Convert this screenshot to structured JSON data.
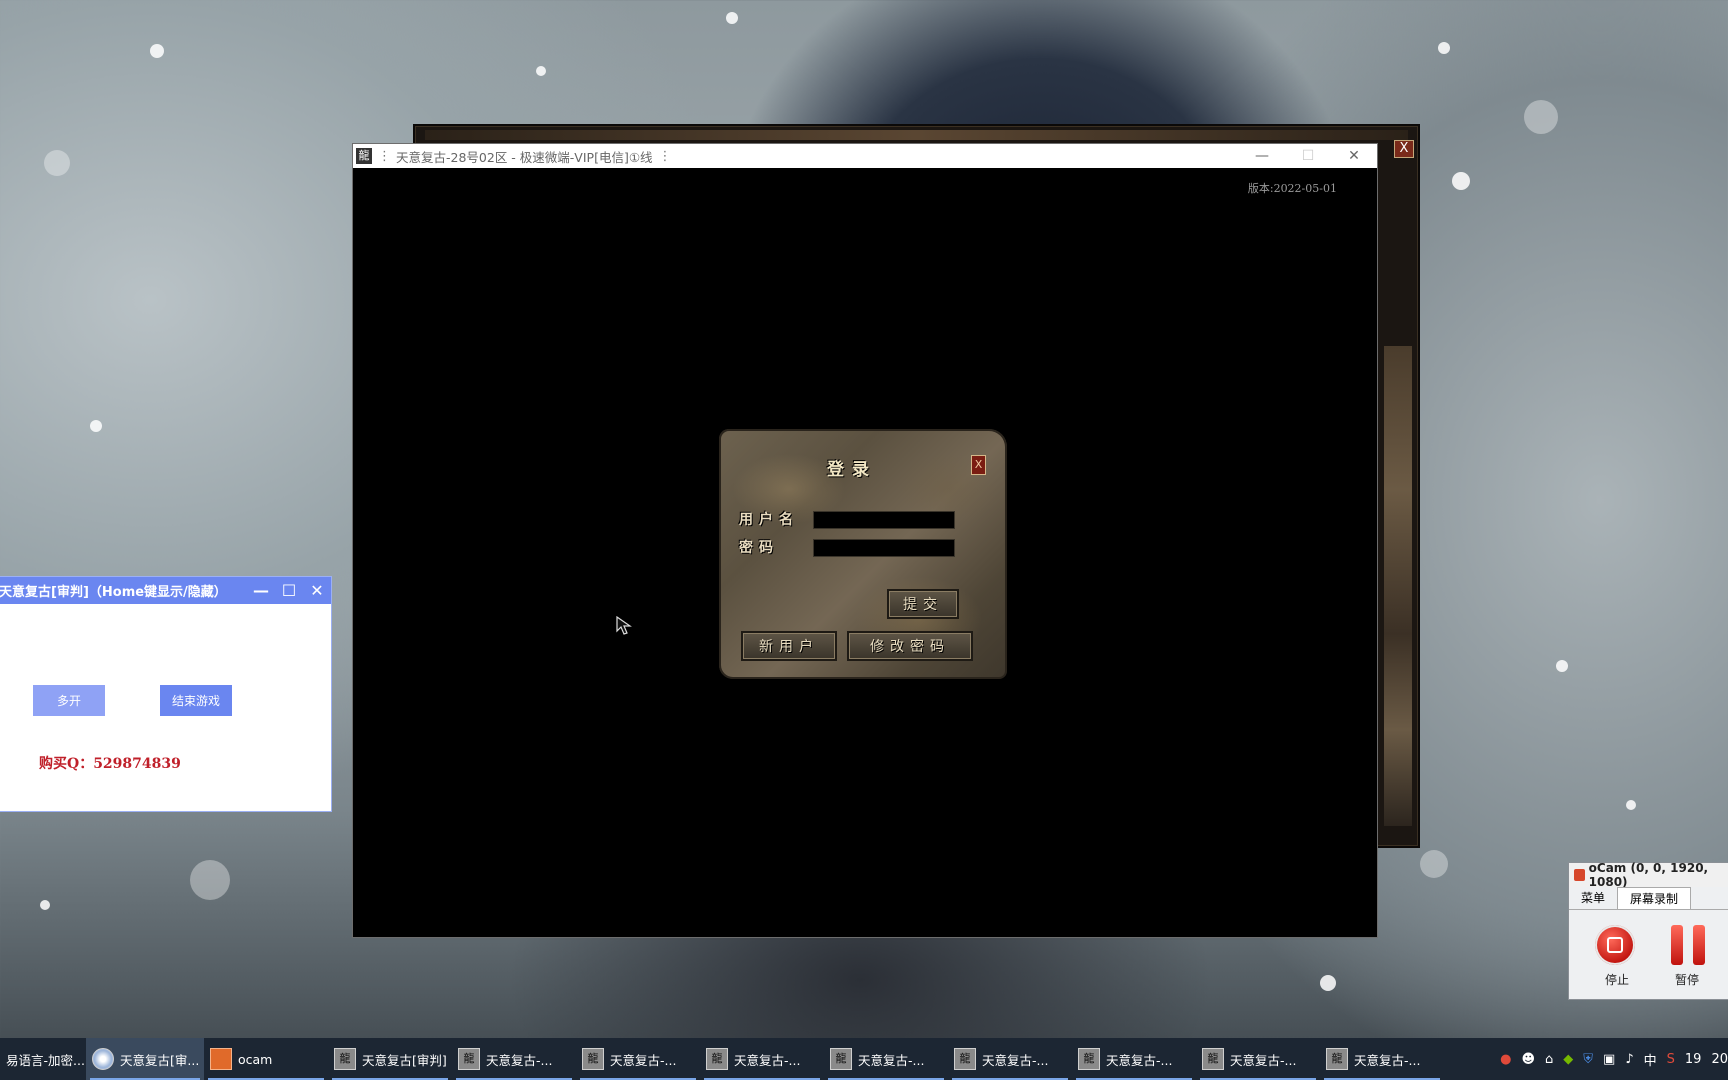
{
  "background_game_window": {
    "close_label": "X"
  },
  "game_window": {
    "title": "天意复古-28号02区 - 极速微端-VIP[电信]①线",
    "controls": {
      "minimize": "—",
      "maximize": "☐",
      "close": "✕"
    },
    "version": "版本:2022-05-01",
    "login": {
      "title": "登录",
      "close_label": "X",
      "username_label": "用户名",
      "password_label": "密码",
      "username_value": "",
      "password_value": "",
      "submit_label": "提交",
      "new_user_label": "新用户",
      "change_password_label": "修改密码"
    }
  },
  "helper_tool": {
    "title": "天意复古[审判]（Home键显示/隐藏）",
    "controls": {
      "minimize": "—",
      "maximize": "☐",
      "close": "✕"
    },
    "multi_open_label": "多开",
    "end_game_label": "结束游戏",
    "buy_text": "购买Q：529874839",
    "colors": {
      "titlebar": "#6a86f0",
      "multi_open": "#8fa2f5",
      "end_game": "#6a86f0",
      "buy_text": "#c0202a"
    }
  },
  "ocam": {
    "title": "oCam (0, 0, 1920, 1080)",
    "tabs": [
      "菜单",
      "屏幕录制"
    ],
    "stop_label": "停止",
    "pause_label": "暂停"
  },
  "taskbar": {
    "items": [
      {
        "label": "易语言-加密...",
        "icon": "app-icon"
      },
      {
        "label": "天意复古[审...",
        "icon": "disc-icon",
        "active": true
      },
      {
        "label": "ocam",
        "icon": "camera-icon"
      },
      {
        "label": "天意复古[审判]",
        "icon": "game-icon"
      },
      {
        "label": "天意复古-...",
        "icon": "game-icon"
      },
      {
        "label": "天意复古-...",
        "icon": "game-icon"
      },
      {
        "label": "天意复古-...",
        "icon": "game-icon"
      },
      {
        "label": "天意复古-...",
        "icon": "game-icon"
      },
      {
        "label": "天意复古-...",
        "icon": "game-icon"
      },
      {
        "label": "天意复古-...",
        "icon": "game-icon"
      },
      {
        "label": "天意复古-...",
        "icon": "game-icon"
      },
      {
        "label": "天意复古-...",
        "icon": "game-icon"
      }
    ],
    "tray": {
      "ime": "中",
      "clock_partial": "19",
      "clock_date_partial": "20"
    }
  }
}
